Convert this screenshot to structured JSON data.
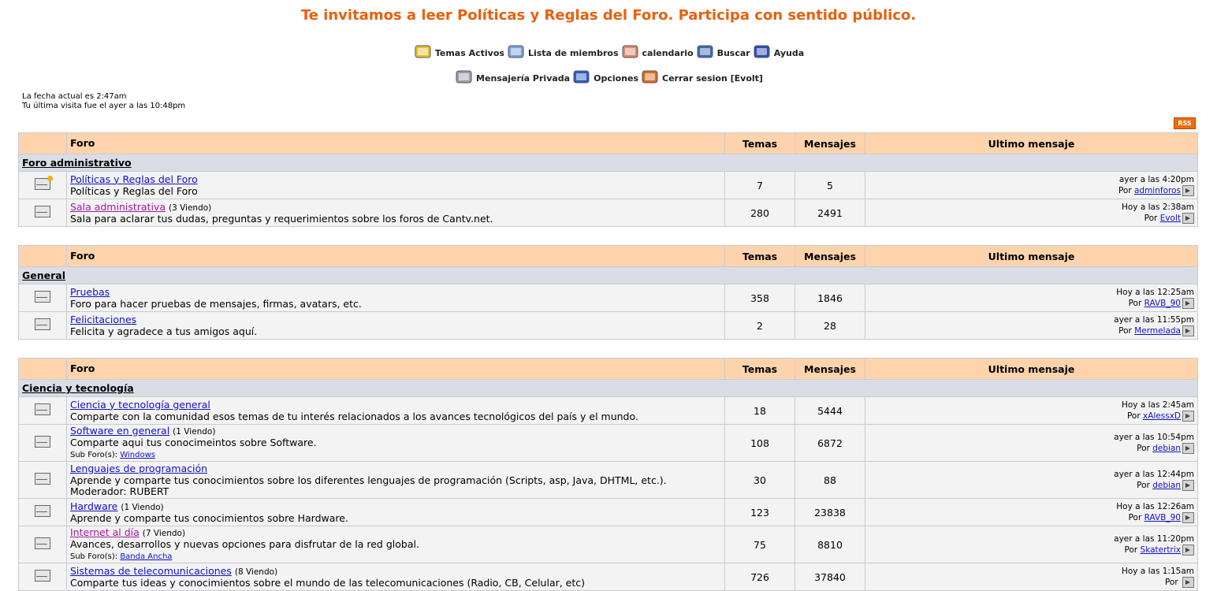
{
  "banner": "Te invitamos a leer Políticas y Reglas del Foro. Participa con sentido público.",
  "nav": {
    "row1": [
      {
        "label": "Temas Activos",
        "icon": "active-topics-icon",
        "color": "#e8c030"
      },
      {
        "label": "Lista de miembros",
        "icon": "members-icon",
        "color": "#7aa0d8"
      },
      {
        "label": "calendario",
        "icon": "calendar-icon",
        "color": "#d98a6a"
      },
      {
        "label": "Buscar",
        "icon": "search-icon",
        "color": "#3a6ab0"
      },
      {
        "label": "Ayuda",
        "icon": "help-icon",
        "color": "#2a4db8"
      }
    ],
    "row2": [
      {
        "label": "Mensajería Privada",
        "icon": "private-message-icon",
        "color": "#9aa0aa"
      },
      {
        "label": "Opciones",
        "icon": "options-icon",
        "color": "#2a59c8"
      },
      {
        "label": "Cerrar sesion [Evolt]",
        "icon": "logout-icon",
        "color": "#d96a1c"
      }
    ]
  },
  "dates": {
    "current": "La fecha actual es 2:47am",
    "last_visit": "Tu última visita fue el ayer a las 10:48pm"
  },
  "rss": "RSS",
  "headers": {
    "foro": "Foro",
    "temas": "Temas",
    "mensajes": "Mensajes",
    "ultimo": "Ultimo mensaje"
  },
  "sections": [
    {
      "category": "Foro administrativo",
      "forums": [
        {
          "name": "Políticas y Reglas del Foro",
          "viewing": "",
          "desc": "Políticas y Reglas del Foro",
          "extra": "",
          "sub_label": "",
          "sub_link": "",
          "temas": "7",
          "mensajes": "5",
          "last_time": "ayer a las 4:20pm",
          "by": "Por",
          "last_user": "adminforos",
          "new": true,
          "visited": false
        },
        {
          "name": "Sala administrativa",
          "viewing": "(3 Viendo)",
          "desc": "Sala para aclarar tus dudas, preguntas y requerimientos sobre los foros de Cantv.net.",
          "extra": "",
          "sub_label": "",
          "sub_link": "",
          "temas": "280",
          "mensajes": "2491",
          "last_time": "Hoy a las 2:38am",
          "by": "Por",
          "last_user": "Evolt",
          "new": false,
          "visited": true
        }
      ]
    },
    {
      "category": "General",
      "forums": [
        {
          "name": "Pruebas",
          "viewing": "",
          "desc": "Foro para hacer pruebas de mensajes, firmas, avatars, etc.",
          "extra": "",
          "sub_label": "",
          "sub_link": "",
          "temas": "358",
          "mensajes": "1846",
          "last_time": "Hoy a las 12:25am",
          "by": "Por",
          "last_user": "RAVB_90",
          "new": false,
          "visited": false
        },
        {
          "name": "Felicitaciones",
          "viewing": "",
          "desc": "Felicita y agradece a tus amigos aquí.",
          "extra": "",
          "sub_label": "",
          "sub_link": "",
          "temas": "2",
          "mensajes": "28",
          "last_time": "ayer a las 11:55pm",
          "by": "Por",
          "last_user": "Mermelada",
          "new": false,
          "visited": false
        }
      ]
    },
    {
      "category": "Ciencia y tecnología",
      "forums": [
        {
          "name": "Ciencia y tecnología general",
          "viewing": "",
          "desc": "Comparte con la comunidad esos temas de tu interés relacionados a los avances tecnológicos del país y el mundo.",
          "extra": "",
          "sub_label": "",
          "sub_link": "",
          "temas": "18",
          "mensajes": "5444",
          "last_time": "Hoy a las 2:45am",
          "by": "Por",
          "last_user": "xAlessxD",
          "new": false,
          "visited": false
        },
        {
          "name": "Software en general",
          "viewing": "(1 Viendo)",
          "desc": "Comparte aqui tus conocimeintos sobre Software.",
          "extra": "",
          "sub_label": "Sub Foro(s):",
          "sub_link": "Windows",
          "temas": "108",
          "mensajes": "6872",
          "last_time": "ayer a las 10:54pm",
          "by": "Por",
          "last_user": "debian",
          "new": false,
          "visited": false
        },
        {
          "name": "Lenguajes de programación",
          "viewing": "",
          "desc": "Aprende y comparte tus conocimientos sobre los diferentes lenguajes de programación (Scripts, asp, Java, DHTML, etc.).",
          "extra": "Moderador: RUBERT",
          "sub_label": "",
          "sub_link": "",
          "temas": "30",
          "mensajes": "88",
          "last_time": "ayer a las 12:44pm",
          "by": "Por",
          "last_user": "debian",
          "new": false,
          "visited": false
        },
        {
          "name": "Hardware",
          "viewing": "(1 Viendo)",
          "desc": "Aprende y comparte tus conocimientos sobre Hardware.",
          "extra": "",
          "sub_label": "",
          "sub_link": "",
          "temas": "123",
          "mensajes": "23838",
          "last_time": "Hoy a las 12:26am",
          "by": "Por",
          "last_user": "RAVB_90",
          "new": false,
          "visited": false
        },
        {
          "name": "Internet al día",
          "viewing": "(7 Viendo)",
          "desc": "Avances, desarrollos y nuevas opciones para disfrutar de la red global.",
          "extra": "",
          "sub_label": "Sub Foro(s):",
          "sub_link": "Banda Ancha",
          "temas": "75",
          "mensajes": "8810",
          "last_time": "ayer a las 11:20pm",
          "by": "Por",
          "last_user": "Skatertrix",
          "new": false,
          "visited": true
        },
        {
          "name": "Sistemas de telecomunicaciones",
          "viewing": "(8 Viendo)",
          "desc": "Comparte tus ideas y conocimientos sobre el mundo de las telecomunicaciones (Radio, CB, Celular, etc)",
          "extra": "",
          "sub_label": "",
          "sub_link": "",
          "temas": "726",
          "mensajes": "37840",
          "last_time": "Hoy a las 1:15am",
          "by": "Por",
          "last_user": "",
          "new": false,
          "visited": false
        }
      ]
    }
  ]
}
